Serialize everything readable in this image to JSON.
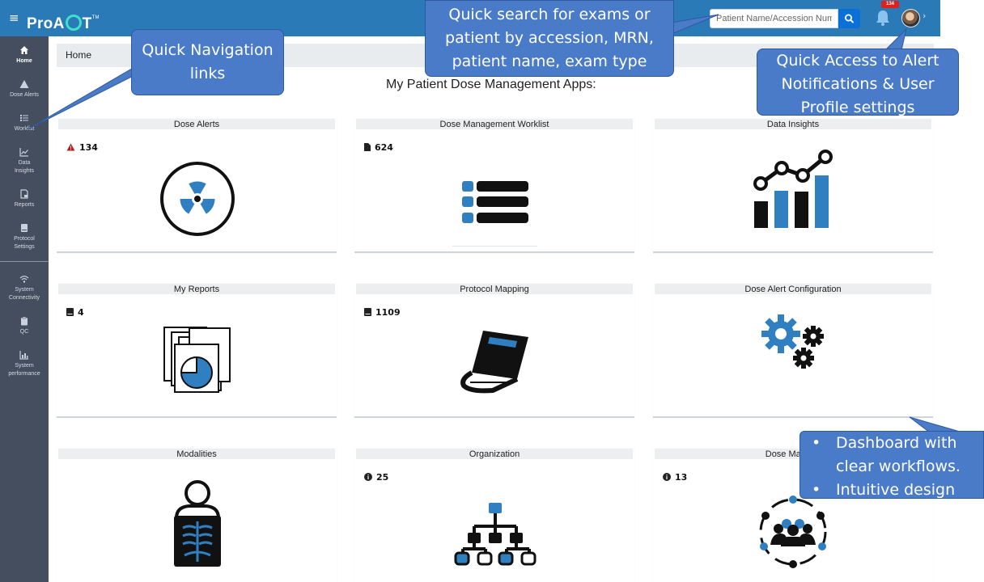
{
  "header": {
    "menu_glyph": "≡",
    "logo": {
      "pre": "ProA",
      "post": "T",
      "tm": "TM"
    },
    "search_placeholder": "Patient Name/Accession Number",
    "notification_count": "134"
  },
  "sidebar": {
    "items": [
      {
        "label": "Home",
        "icon": "home-icon",
        "active": true
      },
      {
        "label": "Dose Alerts",
        "icon": "warning-icon"
      },
      {
        "label": "Worklist",
        "icon": "list-icon"
      },
      {
        "label_line1": "Data",
        "label_line2": "Insights",
        "icon": "line-chart-icon"
      },
      {
        "label": "Reports",
        "icon": "report-icon"
      },
      {
        "label_line1": "Protocol",
        "label_line2": "Settings",
        "icon": "book-icon"
      },
      {
        "label_line1": "System",
        "label_line2": "Connectivity",
        "icon": "wifi-icon"
      },
      {
        "label": "QC",
        "icon": "clipboard-icon"
      },
      {
        "label_line1": "System",
        "label_line2": "performance",
        "icon": "bar-chart-icon"
      }
    ]
  },
  "breadcrumb": {
    "home": "Home"
  },
  "page_title": "My Patient Dose Management Apps:",
  "cards": [
    {
      "title": "Dose Alerts",
      "count": "134",
      "count_icon": "alert-triangle-icon",
      "icon": "radiation-icon"
    },
    {
      "title": "Dose Management Worklist",
      "count": "624",
      "count_icon": "file-icon",
      "icon": "worklist-icon"
    },
    {
      "title": "Data Insights",
      "count": "",
      "icon": "insights-chart-icon"
    },
    {
      "title": "My Reports",
      "count": "4",
      "count_icon": "book-icon",
      "icon": "pie-report-icon"
    },
    {
      "title": "Protocol Mapping",
      "count": "1109",
      "count_icon": "book-icon",
      "icon": "protocol-book-icon"
    },
    {
      "title": "Dose Alert Configuration",
      "count": "",
      "icon": "gears-icon"
    },
    {
      "title": "Modalities",
      "count": "",
      "icon": "xray-patient-icon"
    },
    {
      "title": "Organization",
      "count": "25",
      "count_icon": "info-icon",
      "icon": "org-chart-icon"
    },
    {
      "title": "Dose Manage",
      "count": "13",
      "count_icon": "info-icon",
      "icon": "team-network-icon"
    }
  ],
  "callouts": {
    "nav": "Quick Navigation links",
    "search": "Quick search for exams or patient by accession, MRN, patient name, exam type",
    "alerts": "Quick Access to Alert Notifications & User Profile settings",
    "dashboard_1": "Dashboard with clear workflows.",
    "dashboard_2": "Intuitive design"
  },
  "colors": {
    "header": "#2a7ab8",
    "sidebar": "#444e5e",
    "callout": "#4a7bc8",
    "icon_blue": "#2f7fc1",
    "badge": "#e0201b"
  }
}
